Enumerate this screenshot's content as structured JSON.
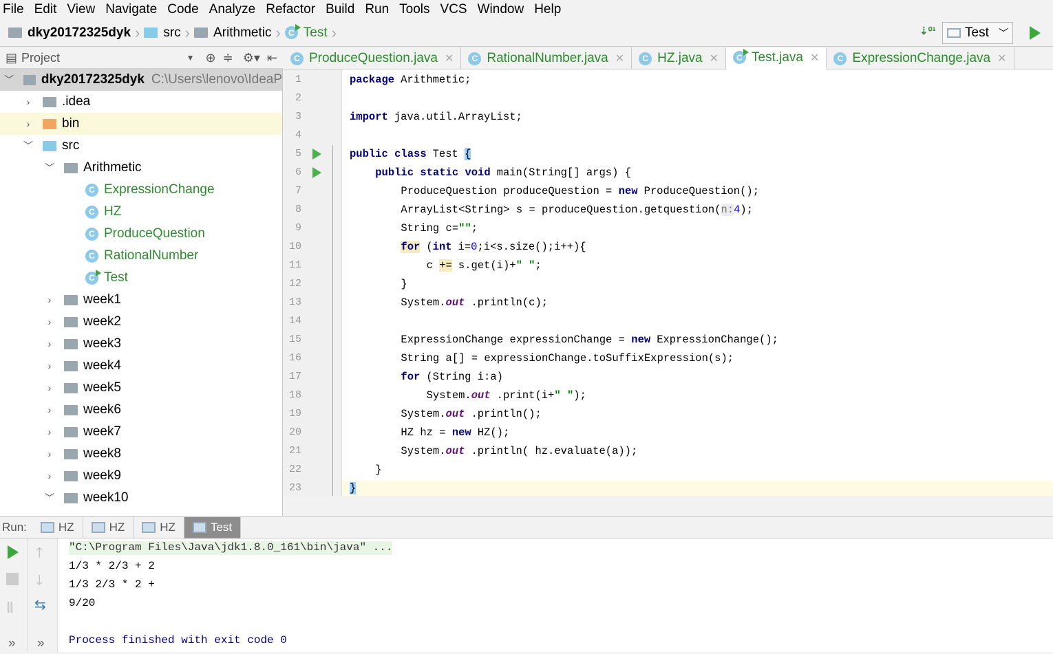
{
  "menu": [
    "File",
    "Edit",
    "View",
    "Navigate",
    "Code",
    "Analyze",
    "Refactor",
    "Build",
    "Run",
    "Tools",
    "VCS",
    "Window",
    "Help"
  ],
  "breadcrumb": [
    "dky20172325dyk",
    "src",
    "Arithmetic",
    "Test"
  ],
  "run_config": "Test",
  "project_panel": {
    "title": "Project",
    "root": "dky20172325dyk",
    "root_path": "C:\\Users\\lenovo\\IdeaP",
    "items": [
      ".idea",
      "bin",
      "src",
      "Arithmetic",
      "ExpressionChange",
      "HZ",
      "ProduceQuestion",
      "RationalNumber",
      "Test",
      "week1",
      "week2",
      "week3",
      "week4",
      "week5",
      "week6",
      "week7",
      "week8",
      "week9",
      "week10"
    ]
  },
  "tabs": [
    "ProduceQuestion.java",
    "RationalNumber.java",
    "HZ.java",
    "Test.java",
    "ExpressionChange.java"
  ],
  "active_tab": "Test.java",
  "code": [
    [
      [
        "kw",
        "package"
      ],
      [
        "",
        "Arithmetic;"
      ]
    ],
    [],
    [
      [
        "kw",
        "import"
      ],
      [
        "",
        "java.util.ArrayList;"
      ]
    ],
    [],
    [
      [
        "kw",
        "public class"
      ],
      [
        "",
        "Test "
      ],
      [
        "brace",
        "{"
      ]
    ],
    [
      [
        "",
        "    "
      ],
      [
        "kw",
        "public static void"
      ],
      [
        "",
        "main(String[] args) {"
      ]
    ],
    [
      [
        "",
        "        ProduceQuestion produceQuestion = "
      ],
      [
        "kw",
        "new"
      ],
      [
        "",
        "ProduceQuestion();"
      ]
    ],
    [
      [
        "",
        "        ArrayList<String> s = produceQuestion.getquestion("
      ],
      [
        "hint",
        "n:"
      ],
      [
        "num",
        "4"
      ],
      [
        "",
        ");"
      ]
    ],
    [
      [
        "",
        "        String c="
      ],
      [
        "str",
        "\"\""
      ],
      [
        "",
        ";"
      ]
    ],
    [
      [
        "",
        "        "
      ],
      [
        "kw mark",
        "for"
      ],
      [
        "",
        "("
      ],
      [
        "kw",
        "int"
      ],
      [
        "",
        "i="
      ],
      [
        "num",
        "0"
      ],
      [
        "",
        ";i<s.size();i++){"
      ]
    ],
    [
      [
        "",
        "            c "
      ],
      [
        "mark",
        "+="
      ],
      [
        "",
        "s.get(i)+"
      ],
      [
        "str",
        "\" \""
      ],
      [
        "",
        ";"
      ]
    ],
    [
      [
        "",
        "        }"
      ]
    ],
    [
      [
        "",
        "        System."
      ],
      [
        "fld",
        "out"
      ],
      [
        "",
        ".println(c);"
      ]
    ],
    [],
    [
      [
        "",
        "        ExpressionChange expressionChange = "
      ],
      [
        "kw",
        "new"
      ],
      [
        "",
        "ExpressionChange();"
      ]
    ],
    [
      [
        "",
        "        String a[] = expressionChange.toSuffixExpression(s);"
      ]
    ],
    [
      [
        "",
        "        "
      ],
      [
        "kw",
        "for"
      ],
      [
        "",
        "(String i:a)"
      ]
    ],
    [
      [
        "",
        "            System."
      ],
      [
        "fld",
        "out"
      ],
      [
        "",
        ".print(i+"
      ],
      [
        "str",
        "\" \""
      ],
      [
        "",
        ");"
      ]
    ],
    [
      [
        "",
        "        System."
      ],
      [
        "fld",
        "out"
      ],
      [
        "",
        ".println();"
      ]
    ],
    [
      [
        "",
        "        HZ hz = "
      ],
      [
        "kw",
        "new"
      ],
      [
        "",
        "HZ();"
      ]
    ],
    [
      [
        "",
        "        System."
      ],
      [
        "fld",
        "out"
      ],
      [
        "",
        ".println( hz.evaluate(a));"
      ]
    ],
    [
      [
        "",
        "    }"
      ]
    ],
    [
      [
        "brace",
        "}"
      ]
    ]
  ],
  "run_panel": {
    "label": "Run:",
    "tabs": [
      "HZ",
      "HZ",
      "HZ",
      "Test"
    ],
    "output": [
      "\"C:\\Program Files\\Java\\jdk1.8.0_161\\bin\\java\" ...",
      "1/3 * 2/3 + 2",
      "1/3 2/3 * 2 +",
      "9/20",
      "",
      "Process finished with exit code 0"
    ]
  }
}
